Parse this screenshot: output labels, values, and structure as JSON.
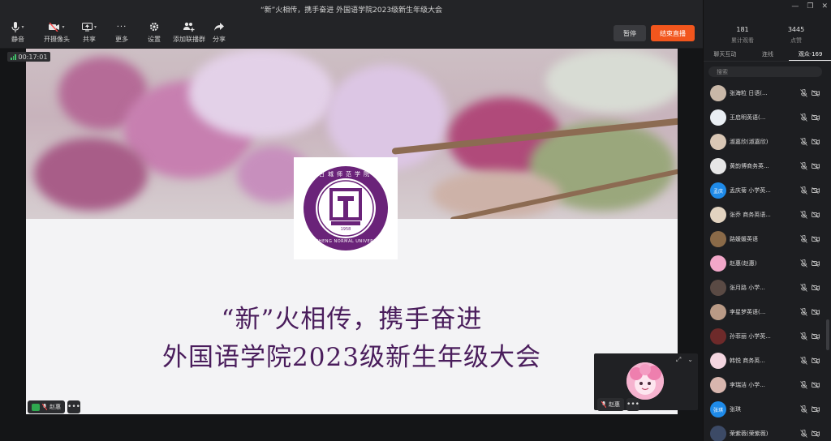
{
  "window": {
    "title": "“新”火相传，携手奋进 外国语学院2023级新生年级大会"
  },
  "toolbar": {
    "items": [
      {
        "label": "静音",
        "icon": "microphone-icon",
        "caret": true
      },
      {
        "label": "开摄像头",
        "icon": "camera-off-icon",
        "caret": true
      },
      {
        "label": "共享",
        "icon": "share-screen-icon",
        "caret": true
      },
      {
        "label": "更多",
        "icon": "more-dots-icon",
        "caret": false
      },
      {
        "label": "设置",
        "icon": "gear-icon",
        "caret": false
      },
      {
        "label": "添加联播群",
        "icon": "add-group-icon",
        "caret": false
      },
      {
        "label": "分享",
        "icon": "share-arrow-icon",
        "caret": false
      }
    ],
    "pause_label": "暂停",
    "end_label": "结束直播"
  },
  "timer": {
    "value": "00:17:01"
  },
  "slide": {
    "line1": "“新”火相传，携手奋进",
    "line2": "外国语学院2023级新生年级大会",
    "logo": {
      "top_text": "白城师范学院",
      "center_glyph": "白師",
      "year": "1958",
      "bottom_text": "BAICHENG NORMAL UNIVERSITY"
    }
  },
  "self_tag": {
    "name": "赵惠",
    "more": "•••"
  },
  "pip": {
    "name": "赵惠",
    "more": "•••"
  },
  "panel": {
    "stats": [
      {
        "num": "181",
        "label": "累计观看"
      },
      {
        "num": "3445",
        "label": "点赞"
      }
    ],
    "tabs": [
      {
        "label": "聊天互动",
        "active": false
      },
      {
        "label": "连线",
        "active": false
      },
      {
        "label": "观众·169",
        "active": true
      }
    ],
    "search_placeholder": "搜索",
    "participants": [
      {
        "name": "张海粒 日语(...",
        "avatar_text": "",
        "avatar_color": "#c9b8a8"
      },
      {
        "name": "王启明英语(...",
        "avatar_text": "",
        "avatar_color": "#e9eef3"
      },
      {
        "name": "淑嘉欣(淑嘉欣)",
        "avatar_text": "",
        "avatar_color": "#d9c7b5"
      },
      {
        "name": "黄韵博商务英...",
        "avatar_text": "",
        "avatar_color": "#e6e6e6"
      },
      {
        "name": "孟庆菊 小学英...",
        "avatar_text": "孟庆",
        "avatar_color": "#1e8ae8"
      },
      {
        "name": "张乔 商务英语...",
        "avatar_text": "",
        "avatar_color": "#e2d3c0"
      },
      {
        "name": "路媛媛英语",
        "avatar_text": "",
        "avatar_color": "#8a6a48"
      },
      {
        "name": "赵惠(赵惠)",
        "avatar_text": "",
        "avatar_color": "#f2a7c9"
      },
      {
        "name": "张月路 小学...",
        "avatar_text": "",
        "avatar_color": "#5a4a44"
      },
      {
        "name": "李星梦英语(...",
        "avatar_text": "",
        "avatar_color": "#b99a86"
      },
      {
        "name": "孙菲丽 小学英...",
        "avatar_text": "",
        "avatar_color": "#6e2a2a"
      },
      {
        "name": "韩悦 商务英...",
        "avatar_text": "",
        "avatar_color": "#f4d6e0"
      },
      {
        "name": "李瑞洁 小学...",
        "avatar_text": "",
        "avatar_color": "#d8b6ae"
      },
      {
        "name": "张琪",
        "avatar_text": "张琪",
        "avatar_color": "#1e8ae8"
      },
      {
        "name": "荣紫薇(荣紫薇)",
        "avatar_text": "",
        "avatar_color": "#3c4a66"
      }
    ]
  }
}
